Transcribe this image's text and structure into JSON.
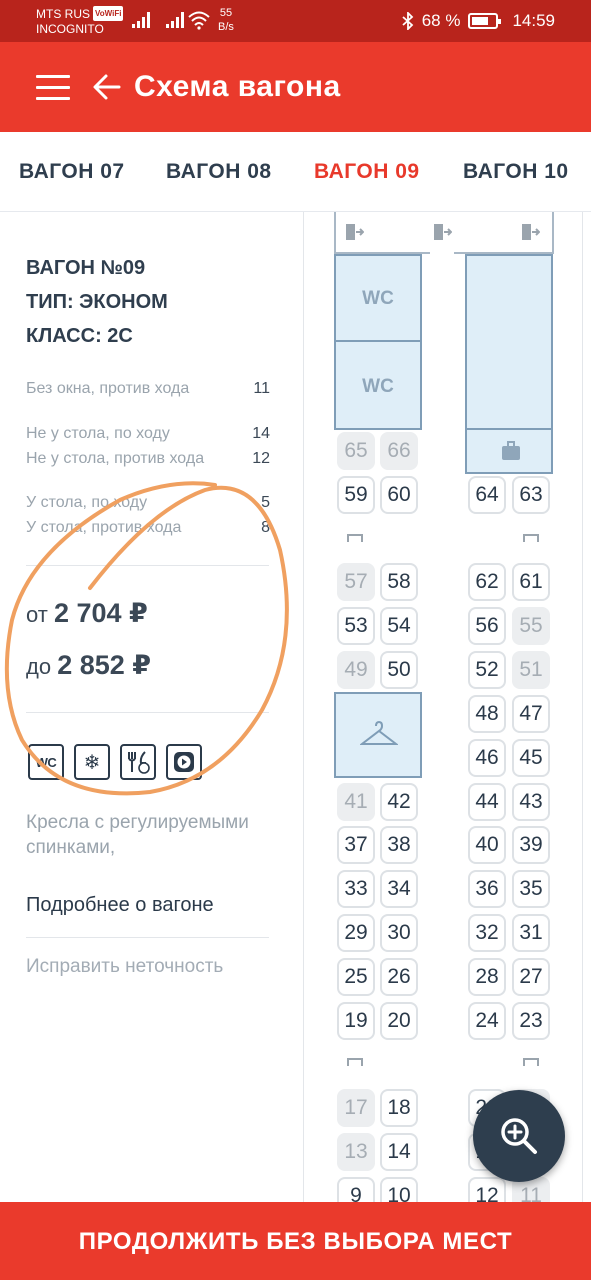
{
  "status_bar": {
    "carrier": "MTS RUS",
    "volte_badge": "VoWiFi",
    "mode": "INCOGNITO",
    "speed_value": "55",
    "speed_unit": "B/s",
    "battery": "68 %",
    "time": "14:59"
  },
  "header": {
    "title": "Схема вагона",
    "menu_icon": "hamburger-icon",
    "back_icon": "arrow-left-icon"
  },
  "tabs": [
    {
      "label": "ВАГОН 07",
      "active": false
    },
    {
      "label": "ВАГОН 08",
      "active": false
    },
    {
      "label": "ВАГОН 09",
      "active": true
    },
    {
      "label": "ВАГОН 10",
      "active": false
    }
  ],
  "car_info": {
    "number": "ВАГОН №09",
    "type": "ТИП: ЭКОНОМ",
    "class": "КЛАСС: 2С",
    "stats": [
      {
        "label": "Без окна, против хода",
        "count": "11"
      },
      {
        "label": "Не у стола, по ходу",
        "count": "14"
      },
      {
        "label": "Не у стола, против хода",
        "count": "12"
      },
      {
        "label": "У стола, по ходу",
        "count": "5"
      },
      {
        "label": "У стола, против хода",
        "count": "8"
      }
    ],
    "price_from_prefix": "от",
    "price_from": "2 704 ₽",
    "price_to_prefix": "до",
    "price_to": "2 852 ₽",
    "amenities": [
      {
        "icon": "wc-icon",
        "text": "WC"
      },
      {
        "icon": "snowflake-icon",
        "text": "❄"
      },
      {
        "icon": "restaurant-icon",
        "text": ""
      },
      {
        "icon": "multimedia-icon",
        "text": ""
      }
    ],
    "description": "Кресла с регулируемыми спинками,",
    "more_link": "Подробнее о вагоне",
    "fix_link": "Исправить неточность"
  },
  "seat_map": {
    "wc_label": "WC",
    "seats": [
      {
        "n": "65",
        "taken": true
      },
      {
        "n": "66",
        "taken": true
      },
      {
        "n": "59",
        "taken": false
      },
      {
        "n": "60",
        "taken": false
      },
      {
        "n": "64",
        "taken": false
      },
      {
        "n": "63",
        "taken": false
      },
      {
        "n": "57",
        "taken": true
      },
      {
        "n": "58",
        "taken": false
      },
      {
        "n": "62",
        "taken": false
      },
      {
        "n": "61",
        "taken": false
      },
      {
        "n": "53",
        "taken": false
      },
      {
        "n": "54",
        "taken": false
      },
      {
        "n": "56",
        "taken": false
      },
      {
        "n": "55",
        "taken": true
      },
      {
        "n": "49",
        "taken": true
      },
      {
        "n": "50",
        "taken": false
      },
      {
        "n": "52",
        "taken": false
      },
      {
        "n": "51",
        "taken": true
      },
      {
        "n": "48",
        "taken": false
      },
      {
        "n": "47",
        "taken": false
      },
      {
        "n": "46",
        "taken": false
      },
      {
        "n": "45",
        "taken": false
      },
      {
        "n": "41",
        "taken": true
      },
      {
        "n": "42",
        "taken": false
      },
      {
        "n": "44",
        "taken": false
      },
      {
        "n": "43",
        "taken": false
      },
      {
        "n": "37",
        "taken": false
      },
      {
        "n": "38",
        "taken": false
      },
      {
        "n": "40",
        "taken": false
      },
      {
        "n": "39",
        "taken": false
      },
      {
        "n": "33",
        "taken": false
      },
      {
        "n": "34",
        "taken": false
      },
      {
        "n": "36",
        "taken": false
      },
      {
        "n": "35",
        "taken": false
      },
      {
        "n": "29",
        "taken": false
      },
      {
        "n": "30",
        "taken": false
      },
      {
        "n": "32",
        "taken": false
      },
      {
        "n": "31",
        "taken": false
      },
      {
        "n": "25",
        "taken": false
      },
      {
        "n": "26",
        "taken": false
      },
      {
        "n": "28",
        "taken": false
      },
      {
        "n": "27",
        "taken": false
      },
      {
        "n": "19",
        "taken": false
      },
      {
        "n": "20",
        "taken": false
      },
      {
        "n": "24",
        "taken": false
      },
      {
        "n": "23",
        "taken": false
      },
      {
        "n": "17",
        "taken": true
      },
      {
        "n": "18",
        "taken": false
      },
      {
        "n": "22",
        "taken": false
      },
      {
        "n": "21",
        "taken": true
      },
      {
        "n": "13",
        "taken": true
      },
      {
        "n": "14",
        "taken": false
      },
      {
        "n": "16",
        "taken": false
      },
      {
        "n": "9",
        "taken": false
      },
      {
        "n": "10",
        "taken": false
      },
      {
        "n": "12",
        "taken": false
      },
      {
        "n": "11",
        "taken": true
      }
    ]
  },
  "zoom_icon": "zoom-in-icon",
  "bottom_button": "ПРОДОЛЖИТЬ БЕЗ ВЫБОРА МЕСТ",
  "colors": {
    "brand_red": "#ea3a2c",
    "status_red": "#b8241c",
    "active_tab": "#e8392b",
    "annotation": "#f0a060"
  }
}
